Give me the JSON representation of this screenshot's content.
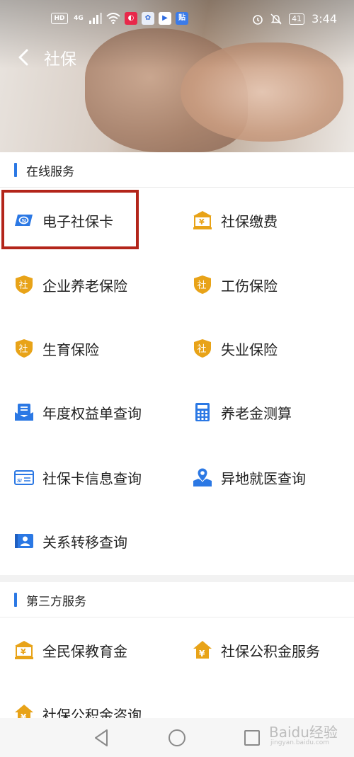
{
  "status_bar": {
    "left_icons": [
      "HD",
      "4G",
      "signal-icon",
      "wifi-icon",
      "app-red-icon",
      "app-blue-icon",
      "app-video-icon",
      "app-tieba-icon"
    ],
    "battery": "41",
    "time": "3:44"
  },
  "header": {
    "title": "社保"
  },
  "sections": {
    "online": {
      "title": "在线服务",
      "items": [
        {
          "label": "电子社保卡",
          "icon": "ss-card-icon"
        },
        {
          "label": "社保缴费",
          "icon": "bank-icon"
        },
        {
          "label": "企业养老保险",
          "icon": "shield-she-icon"
        },
        {
          "label": "工伤保险",
          "icon": "shield-she-icon"
        },
        {
          "label": "生育保险",
          "icon": "shield-she-icon"
        },
        {
          "label": "失业保险",
          "icon": "shield-she-icon"
        },
        {
          "label": "年度权益单查询",
          "icon": "statement-icon"
        },
        {
          "label": "养老金测算",
          "icon": "calculator-icon"
        },
        {
          "label": "社保卡信息查询",
          "icon": "si-card-icon"
        },
        {
          "label": "异地就医查询",
          "icon": "map-pin-icon"
        },
        {
          "label": "关系转移查询",
          "icon": "transfer-icon"
        }
      ]
    },
    "third_party": {
      "title": "第三方服务",
      "items": [
        {
          "label": "全民保教育金",
          "icon": "bank-icon"
        },
        {
          "label": "社保公积金服务",
          "icon": "yen-house-icon"
        },
        {
          "label": "社保公积金咨询",
          "icon": "yen-house-icon"
        }
      ]
    }
  },
  "watermark": {
    "main": "Baidu经验",
    "sub": "jingyan.baidu.com"
  },
  "colors": {
    "accent_blue": "#2b78e4",
    "gold": "#e8a318",
    "highlight": "#b3251a"
  }
}
